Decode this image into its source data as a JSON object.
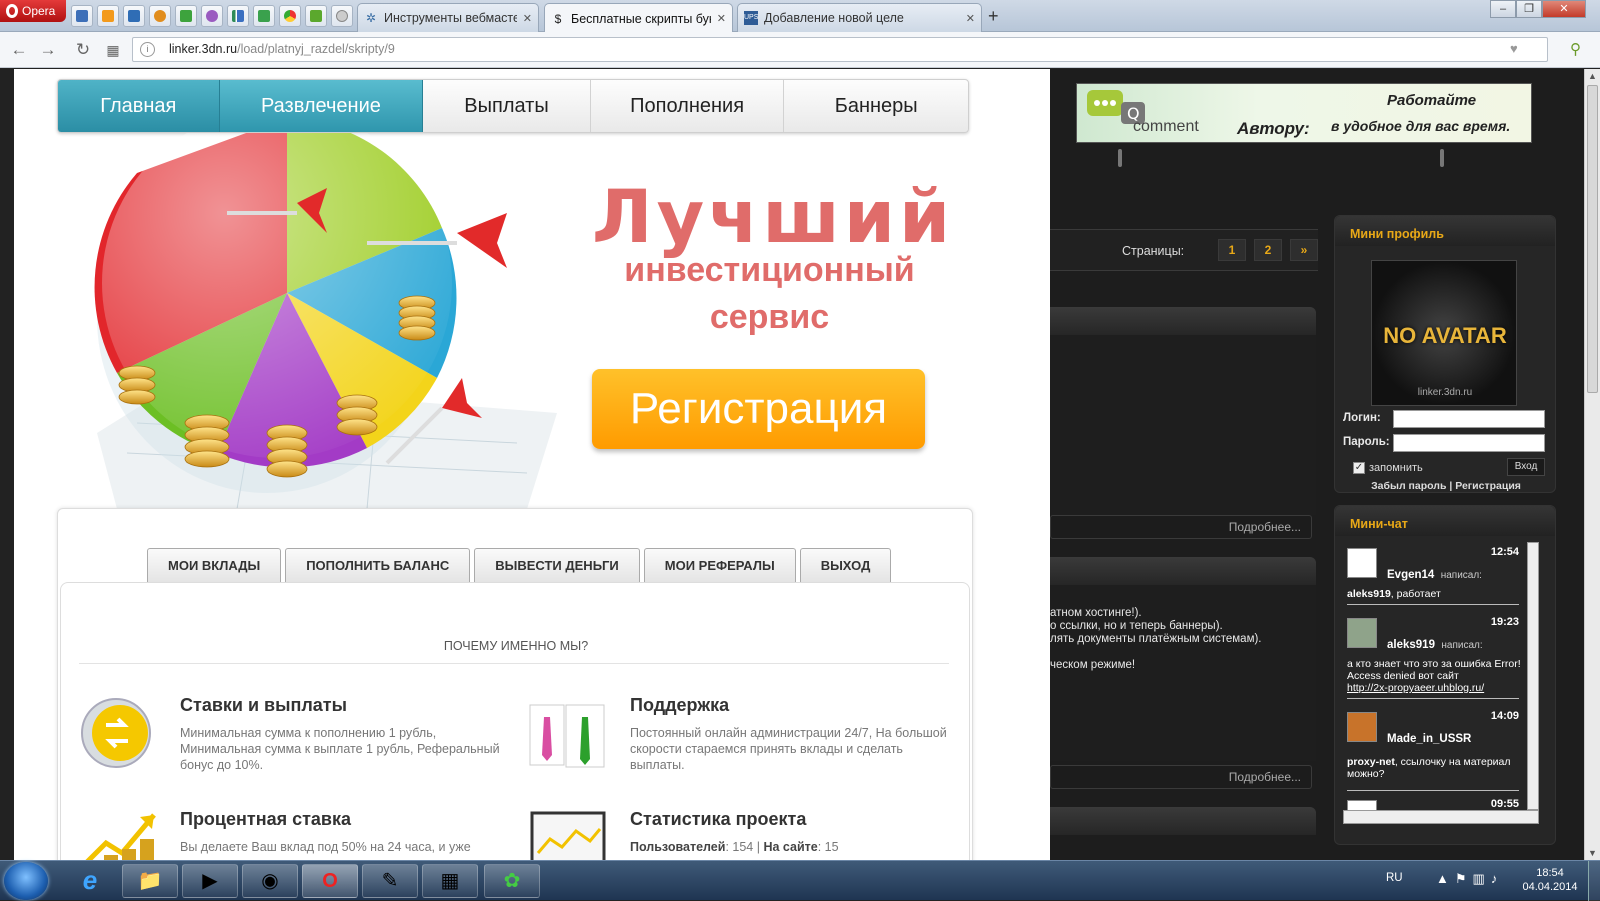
{
  "browser": {
    "menu_label": "Opera",
    "tabs": [
      {
        "label": "Инструменты вебмастер",
        "icon": "wrench-icon",
        "active": false
      },
      {
        "label": "Бесплатные скрипты бук",
        "icon": "dollar-icon",
        "active": true
      },
      {
        "label": "Добавление новой целе",
        "icon": "ups-icon",
        "active": false
      }
    ],
    "url_host": "linker.3dn.ru",
    "url_path": "/load/platnyj_razdel/skripty/9",
    "window_controls": [
      "–",
      "❐",
      "✕"
    ]
  },
  "site": {
    "nav": [
      "Главная",
      "Развлечение",
      "Выплаты",
      "Пополнения",
      "Баннеры"
    ],
    "hero": {
      "title": "Лучший",
      "subtitle_line1": "инвестиционный",
      "subtitle_line2": "сервис",
      "register_button": "Регистрация"
    },
    "account_tabs": [
      "МОИ ВКЛАДЫ",
      "ПОПОЛНИТЬ БАЛАНС",
      "ВЫВЕСТИ ДЕНЬГИ",
      "МОИ РЕФЕРАЛЫ",
      "ВЫХОД"
    ],
    "why_heading": "ПОЧЕМУ ИМЕННО МЫ?",
    "features": [
      {
        "title": "Ставки и выплаты",
        "text": "Минимальная сумма к пополнению 1 рубль, Минимальная сумма к выплате 1 рубль, Реферальный бонус до 10%."
      },
      {
        "title": "Поддержка",
        "text": "Постоянный онлайн администрации 24/7, На большой скорости стараемся принять вклады и сделать выплаты."
      },
      {
        "title": "Процентная ставка",
        "text": "Вы делаете Ваш вклад под 50% на 24 часа, и уже"
      },
      {
        "title": "Статистика проекта",
        "stats_users_label": "Пользователей",
        "stats_users": ": 154 | ",
        "stats_online_label": "На сайте",
        "stats_online": ": 15"
      }
    ]
  },
  "sidebar": {
    "banner": {
      "comment": "comment",
      "autor": "Автору:",
      "line1": "Работайте",
      "line2": "в удобное для вас время."
    },
    "pages_label": "Страницы:",
    "pages": [
      "1",
      "2",
      "»"
    ],
    "more_label": "Подробнее...",
    "news_lines": [
      "атном хостинге!).",
      "о ссылки, но и теперь баннеры).",
      "лять документы платёжным системам).",
      "ческом режиме!"
    ],
    "mini_profile": {
      "title": "Мини профиль",
      "avatar_text": "NO AVATAR",
      "avatar_domain": "linker.3dn.ru",
      "login_label": "Логин:",
      "password_label": "Пароль:",
      "remember_label": "запомнить",
      "login_button": "Вход",
      "forgot": "Забыл пароль",
      "register": "Регистрация"
    },
    "mini_chat": {
      "title": "Мини-чат",
      "wrote_label": "написал:",
      "messages": [
        {
          "time": "12:54",
          "user": "Evgen14",
          "text_user": "aleks919",
          "text": ", работает"
        },
        {
          "time": "19:23",
          "user": "aleks919",
          "text": "а кто знает что это за ошибка Error! Access denied вот сайт",
          "link": "http://2x-propyaeer.uhblog.ru/"
        },
        {
          "time": "14:09",
          "user": "Made_in_USSR",
          "text_user": "proxy-net",
          "text": ", ссылочку на материал можно?"
        },
        {
          "time": "09:55",
          "user": "",
          "text": ""
        }
      ]
    }
  },
  "taskbar": {
    "language": "RU",
    "time": "18:54",
    "date": "04.04.2014"
  }
}
